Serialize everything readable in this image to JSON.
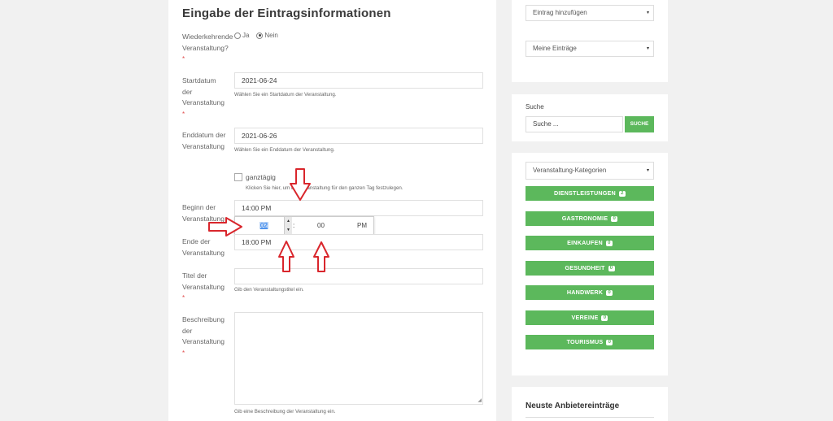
{
  "form": {
    "title": "Eingabe der Eintragsinformationen",
    "recurring": {
      "label": "Wiederkehrende Veranstaltung?",
      "required": "*",
      "options": [
        "Ja",
        "Nein"
      ],
      "selected": "Nein"
    },
    "start_date": {
      "label": "Startdatum der Veranstaltung",
      "required": "*",
      "value": "2021-06-24",
      "help": "Wählen Sie ein Startdatum der Veranstaltung."
    },
    "end_date": {
      "label": "Enddatum der Veranstaltung",
      "value": "2021-06-26",
      "help": "Wählen Sie ein Enddatum der Veranstaltung."
    },
    "all_day": {
      "label": "ganztägig",
      "help": "Klicken Sie hier, um die Veranstaltung für den ganzen Tag festzulegen."
    },
    "start_time": {
      "label": "Beginn der Veranstaltung",
      "value": "14:00 PM"
    },
    "time_picker": {
      "hour": "02",
      "colon": ":",
      "minute": "00",
      "ampm": "PM",
      "up": "▲",
      "down": "▼"
    },
    "end_time": {
      "label": "Ende der Veranstaltung",
      "value": "18:00 PM"
    },
    "event_title": {
      "label": "Titel der Veranstaltung",
      "required": "*",
      "value": "",
      "help": "Gib den Veranstaltungstitel ein."
    },
    "description": {
      "label": "Beschreibung der Veranstaltung",
      "required": "*",
      "help": "Gib eine Beschreibung der Veranstaltung ein."
    }
  },
  "sidebar": {
    "add_entry": "Eintrag hinzufügen",
    "my_entries": "Meine Einträge",
    "search_title": "Suche",
    "search_placeholder": "Suche ...",
    "search_button": "SUCHE",
    "category_select": "Veranstaltung-Kategorien",
    "categories": [
      {
        "label": "DIENSTLEISTUNGEN",
        "count": "2"
      },
      {
        "label": "GASTRONOMIE",
        "count": "0"
      },
      {
        "label": "EINKAUFEN",
        "count": "0"
      },
      {
        "label": "GESUNDHEIT",
        "count": "0"
      },
      {
        "label": "HANDWERK",
        "count": "0"
      },
      {
        "label": "VEREINE",
        "count": "0"
      },
      {
        "label": "TOURISMUS",
        "count": "0"
      }
    ],
    "newest_title": "Neuste Anbietereinträge"
  },
  "colors": {
    "accent": "#5cb85c",
    "annotation_arrow": "#d9262c"
  },
  "caret": "▾"
}
